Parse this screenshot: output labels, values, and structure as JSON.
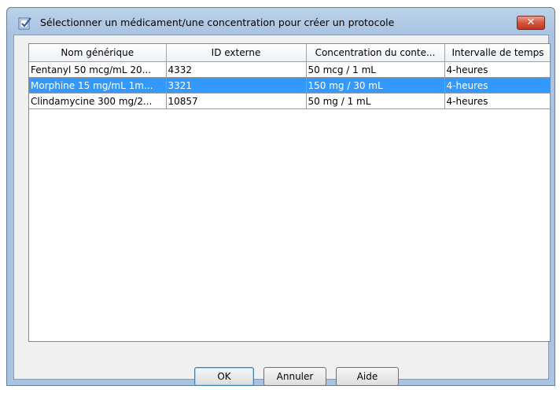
{
  "window": {
    "title": "Sélectionner un médicament/une concentration pour créer un protocole",
    "close_label": "✕"
  },
  "table": {
    "columns": [
      "Nom générique",
      "ID externe",
      "Concentration du conte...",
      "Intervalle de temps"
    ],
    "rows": [
      [
        "Fentanyl 50 mcg/mL 20...",
        "4332",
        "50 mcg / 1 mL",
        "4-heures"
      ],
      [
        "Morphine 15 mg/mL  1m...",
        "3321",
        "150 mg / 30 mL",
        "4-heures"
      ],
      [
        "Clindamycine 300 mg/2...",
        "10857",
        "50 mg / 1 mL",
        "4-heures"
      ]
    ],
    "selected_row_index": 1
  },
  "buttons": {
    "ok_label": "OK",
    "cancel_label": "Annuler",
    "help_label": "Aide"
  },
  "colors": {
    "selection": "#3399ff",
    "titlebar": "#a9c3e2",
    "close_button": "#c0391f"
  }
}
